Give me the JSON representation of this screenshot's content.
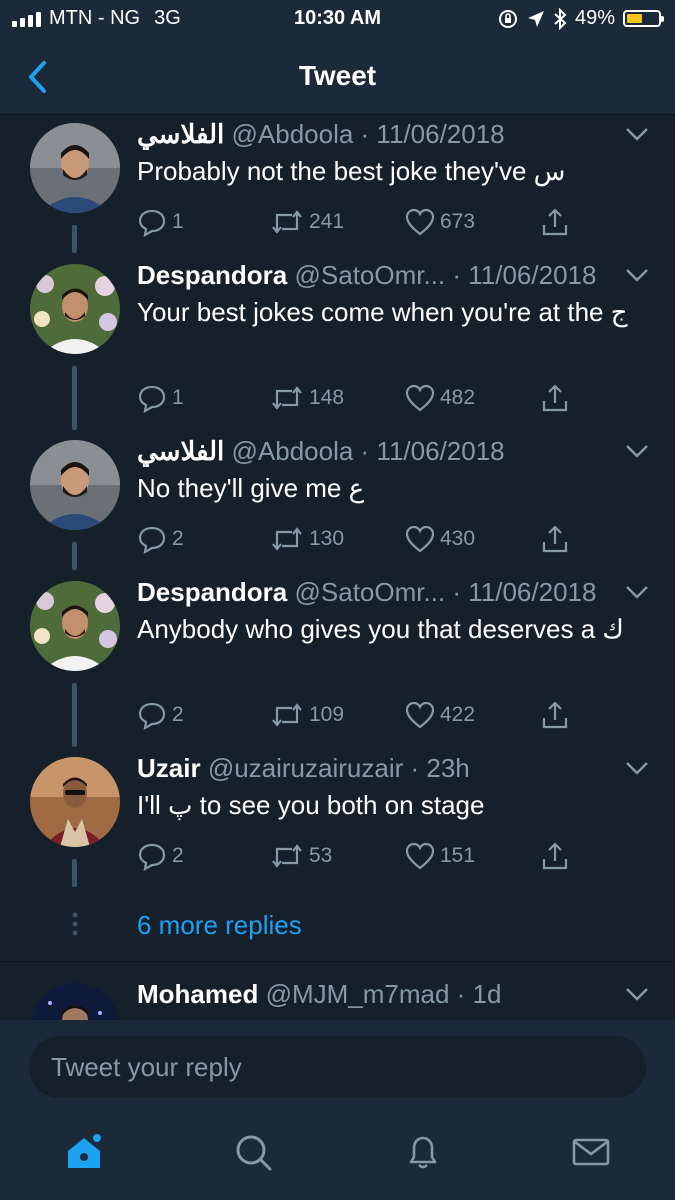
{
  "status_bar": {
    "carrier": "MTN - NG",
    "network": "3G",
    "time": "10:30 AM",
    "battery_pct": "49%",
    "battery_level": 0.49
  },
  "nav": {
    "title": "Tweet",
    "back_icon": "chevron-left-icon"
  },
  "tweets": [
    {
      "name": "الفلاسي",
      "meta": "@Abdoola · 11/06/2018",
      "text": "Probably not the best joke they've س",
      "replies": "1",
      "retweets": "241",
      "likes": "673"
    },
    {
      "name": "Despandora",
      "meta": "@SatoOmr... · 11/06/2018",
      "text": "Your best jokes come when you're at the ج",
      "replies": "1",
      "retweets": "148",
      "likes": "482"
    },
    {
      "name": "الفلاسي",
      "meta": "@Abdoola · 11/06/2018",
      "text": "No they'll give me ع",
      "replies": "2",
      "retweets": "130",
      "likes": "430"
    },
    {
      "name": "Despandora",
      "meta": "@SatoOmr... · 11/06/2018",
      "text": "Anybody who gives you that deserves a ك",
      "replies": "2",
      "retweets": "109",
      "likes": "422"
    },
    {
      "name": "Uzair",
      "meta": "@uzairuzairuzair · 23h",
      "text": "I'll پ to see you both on stage",
      "replies": "2",
      "retweets": "53",
      "likes": "151"
    },
    {
      "name": "Mohamed",
      "meta": "@MJM_m7mad · 1d"
    }
  ],
  "more_replies": "6 more replies",
  "reply_box": {
    "placeholder": "Tweet your reply"
  },
  "tab_bar": {
    "icons": [
      "home-icon",
      "search-icon",
      "bell-icon",
      "mail-icon"
    ]
  },
  "colors": {
    "background": "#15202b",
    "bar": "#1c2938",
    "accent": "#1da1f2",
    "muted": "#8899a6",
    "battery": "#f5c518"
  }
}
